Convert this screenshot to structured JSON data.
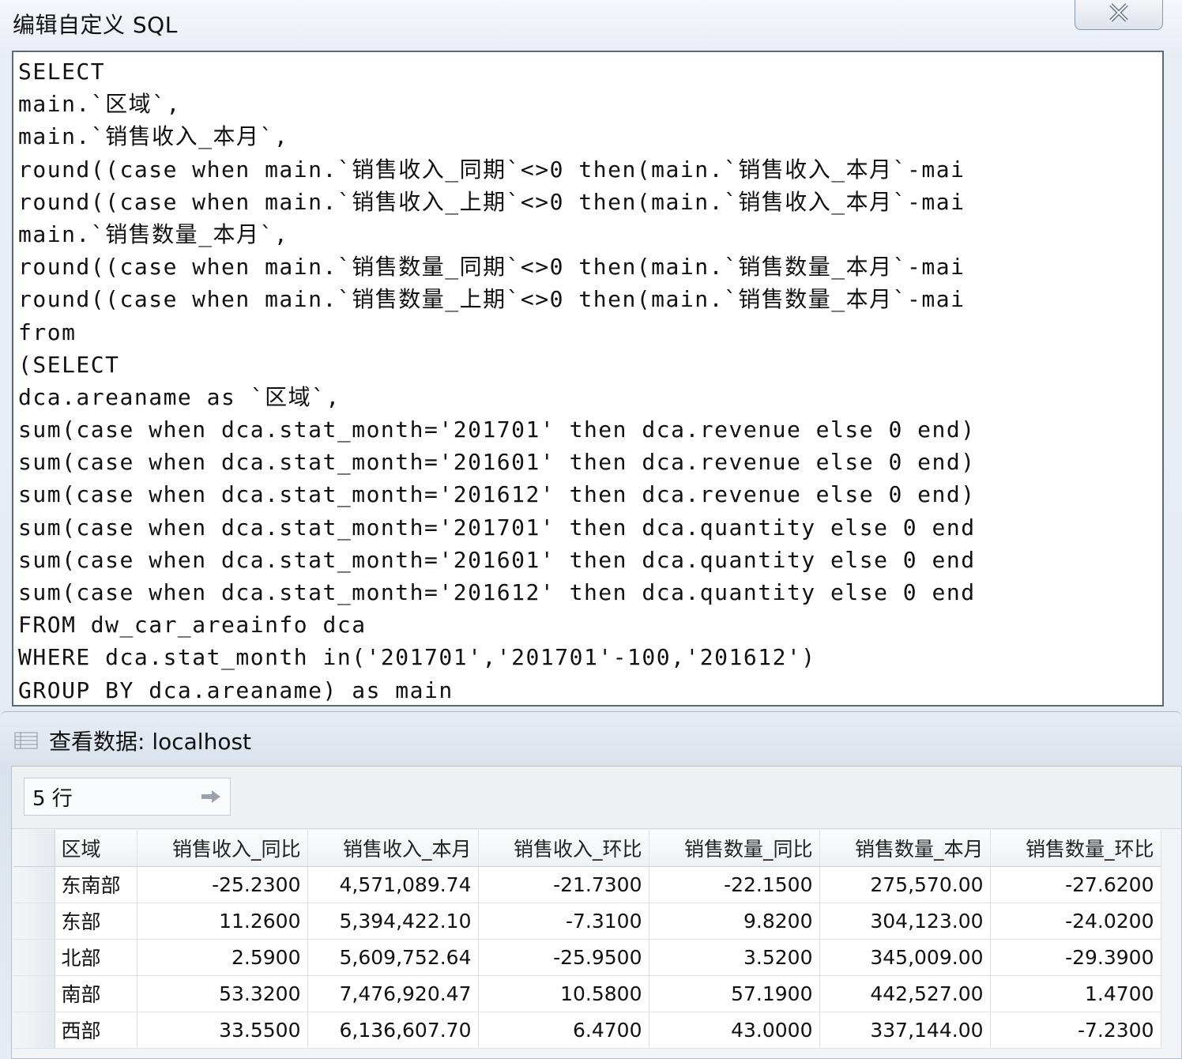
{
  "sql_dialog": {
    "title": "编辑自定义 SQL",
    "lines": [
      "SELECT",
      "main.`区域`,",
      "main.`销售收入_本月`,",
      "round((case when main.`销售收入_同期`<>0 then(main.`销售收入_本月`-mai",
      "round((case when main.`销售收入_上期`<>0 then(main.`销售收入_本月`-mai",
      "main.`销售数量_本月`,",
      "round((case when main.`销售数量_同期`<>0 then(main.`销售数量_本月`-mai",
      "round((case when main.`销售数量_上期`<>0 then(main.`销售数量_本月`-mai",
      "from",
      "(SELECT",
      "dca.areaname as `区域`,",
      "sum(case when dca.stat_month='201701' then dca.revenue else 0 end)",
      "sum(case when dca.stat_month='201601' then dca.revenue else 0 end)",
      "sum(case when dca.stat_month='201612' then dca.revenue else 0 end)",
      "sum(case when dca.stat_month='201701' then dca.quantity else 0 end",
      "sum(case when dca.stat_month='201601' then dca.quantity else 0 end",
      "sum(case when dca.stat_month='201612' then dca.quantity else 0 end",
      "FROM dw_car_areainfo dca",
      "WHERE dca.stat_month in('201701','201701'-100,'201612')",
      "GROUP BY dca.areaname) as main"
    ]
  },
  "data_window": {
    "title": "查看数据: localhost",
    "row_count": "5 行",
    "columns": [
      "区域",
      "销售收入_同比",
      "销售收入_本月",
      "销售收入_环比",
      "销售数量_同比",
      "销售数量_本月",
      "销售数量_环比"
    ],
    "rows": [
      [
        "东南部",
        "-25.2300",
        "4,571,089.74",
        "-21.7300",
        "-22.1500",
        "275,570.00",
        "-27.6200"
      ],
      [
        "东部",
        "11.2600",
        "5,394,422.10",
        "-7.3100",
        "9.8200",
        "304,123.00",
        "-24.0200"
      ],
      [
        "北部",
        "2.5900",
        "5,609,752.64",
        "-25.9500",
        "3.5200",
        "345,009.00",
        "-29.3900"
      ],
      [
        "南部",
        "53.3200",
        "7,476,920.47",
        "10.5800",
        "57.1900",
        "442,527.00",
        "1.4700"
      ],
      [
        "西部",
        "33.5500",
        "6,136,607.70",
        "6.4700",
        "43.0000",
        "337,144.00",
        "-7.2300"
      ]
    ]
  }
}
